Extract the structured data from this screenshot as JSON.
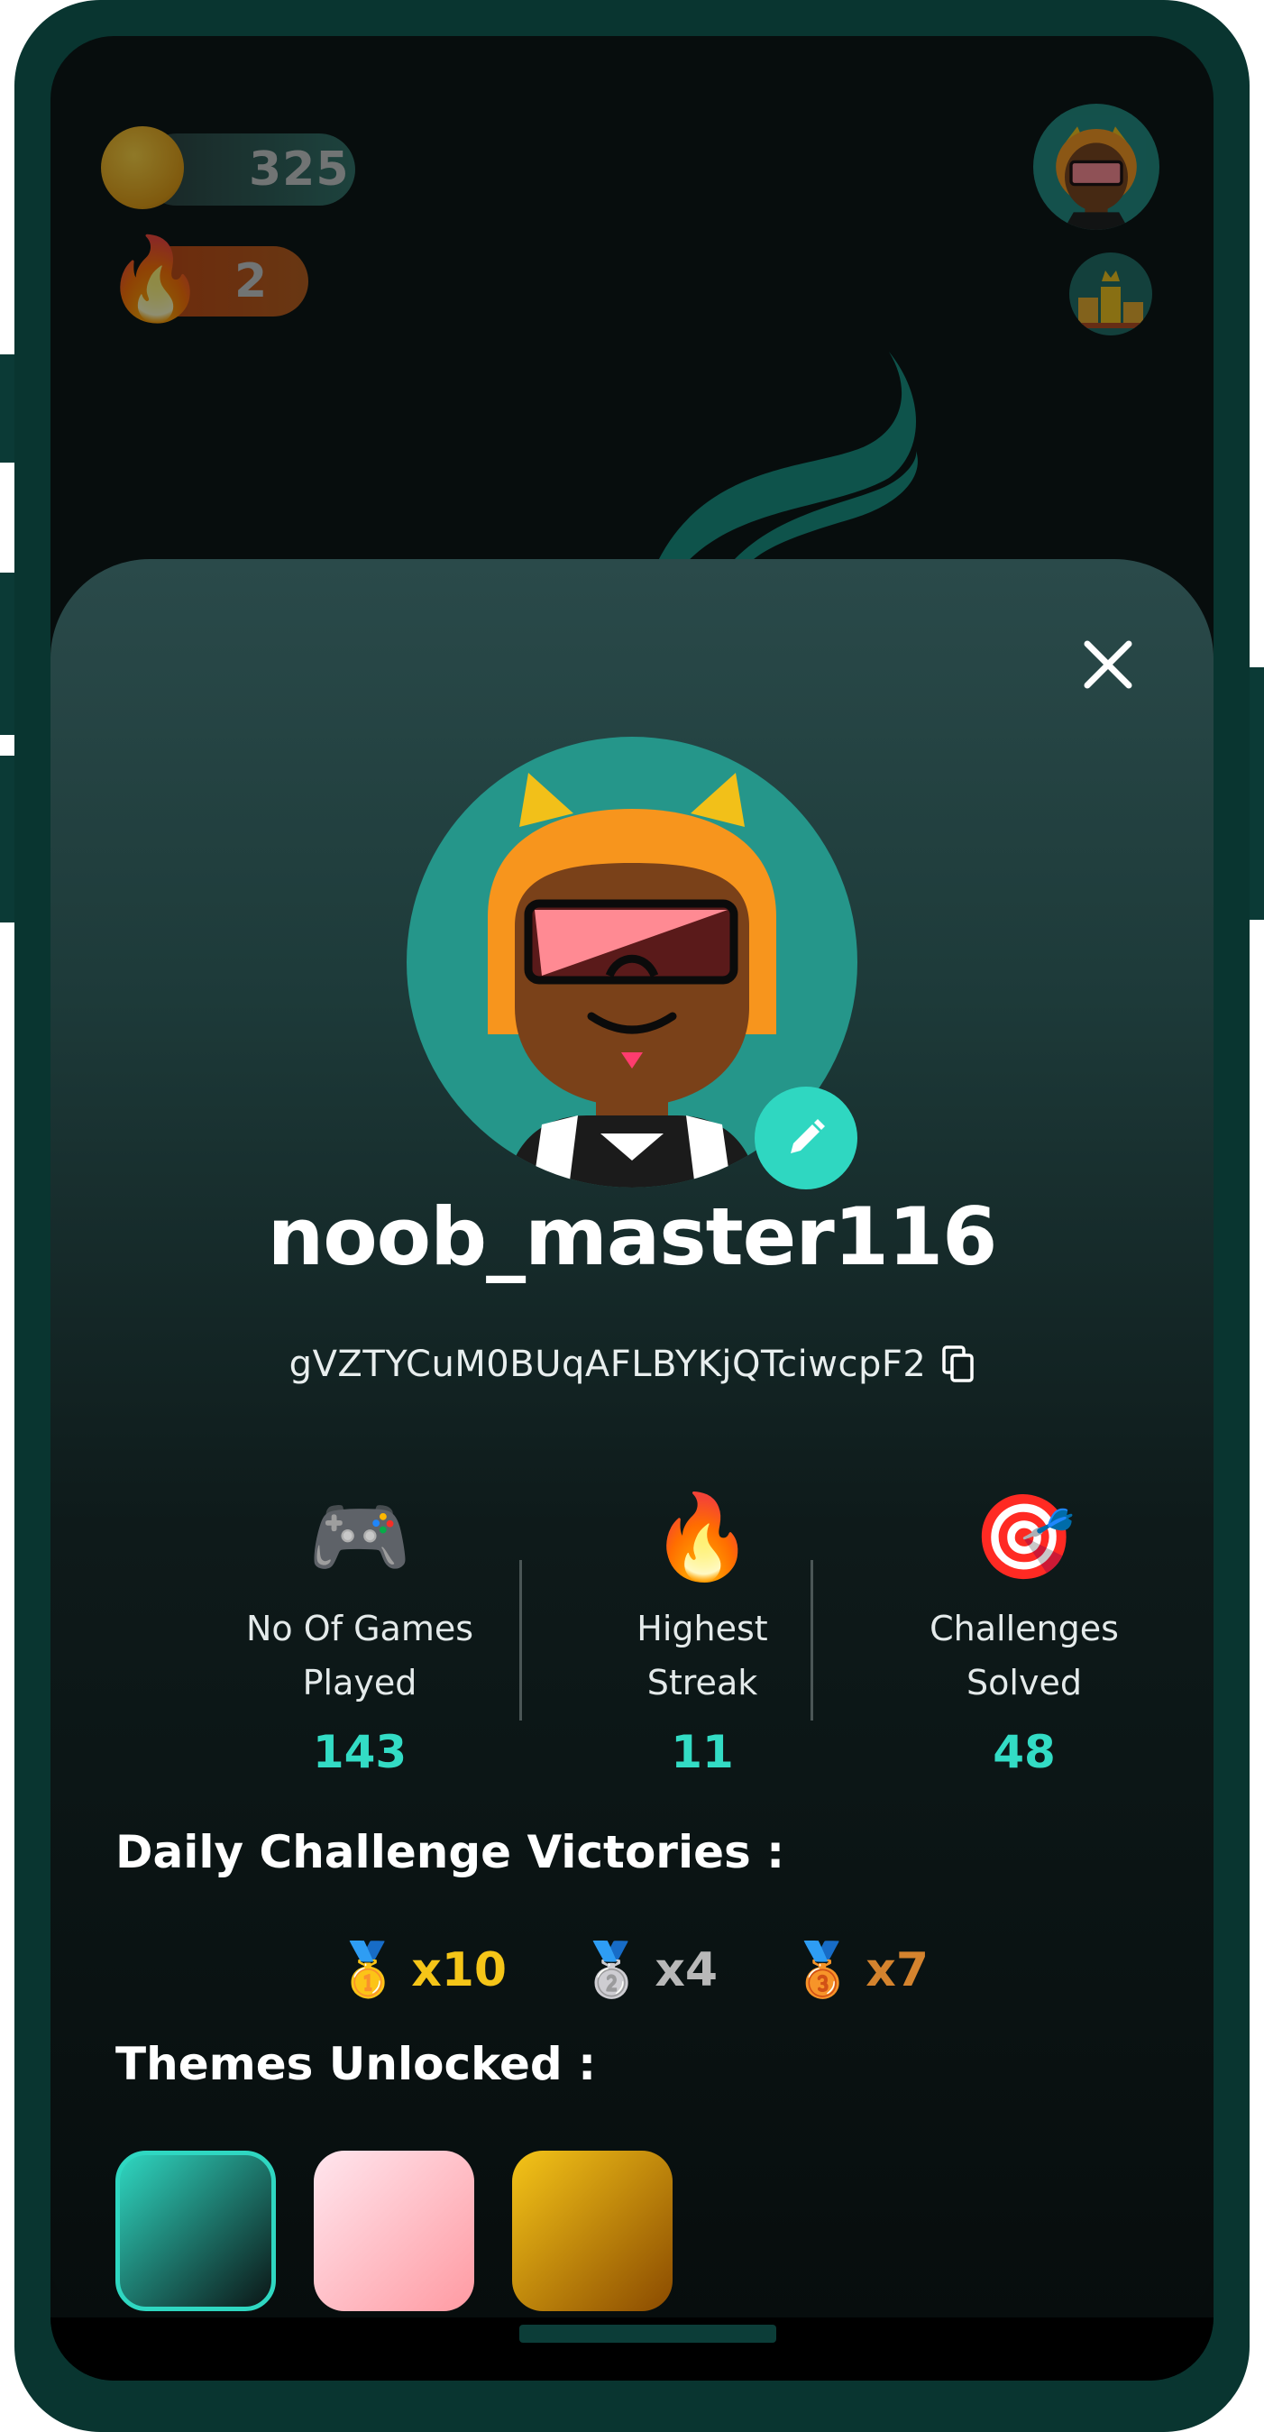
{
  "hud": {
    "coins": "325",
    "streak": "2"
  },
  "profile": {
    "username": "noob_master116",
    "user_id": "gVZTYCuM0BUqAFLBYKjQTciwcpF2"
  },
  "stats": [
    {
      "icon": "🎮",
      "label_line1": "No Of Games",
      "label_line2": "Played",
      "value": "143"
    },
    {
      "icon": "🔥",
      "label_line1": "Highest",
      "label_line2": "Streak",
      "value": "11"
    },
    {
      "icon": "🎯",
      "label_line1": "Challenges",
      "label_line2": "Solved",
      "value": "48"
    }
  ],
  "daily": {
    "title": "Daily Challenge Victories :",
    "medals": [
      {
        "icon": "🥇",
        "count": "x10",
        "color": "#f5c518"
      },
      {
        "icon": "🥈",
        "count": "x4",
        "color": "#b8b8b8"
      },
      {
        "icon": "🥉",
        "count": "x7",
        "color": "#d4832e"
      }
    ]
  },
  "themes": {
    "title": "Themes Unlocked :",
    "items": [
      {
        "name": "teal",
        "gradient": [
          "#2fd7c1",
          "#0b1515"
        ],
        "selected": true
      },
      {
        "name": "pink",
        "gradient": [
          "#ffe6ee",
          "#ff9aa2"
        ],
        "selected": false
      },
      {
        "name": "gold",
        "gradient": [
          "#f5c518",
          "#8a4a00"
        ],
        "selected": false
      }
    ]
  },
  "colors": {
    "accent": "#2fd7c1",
    "frame": "#093530"
  }
}
